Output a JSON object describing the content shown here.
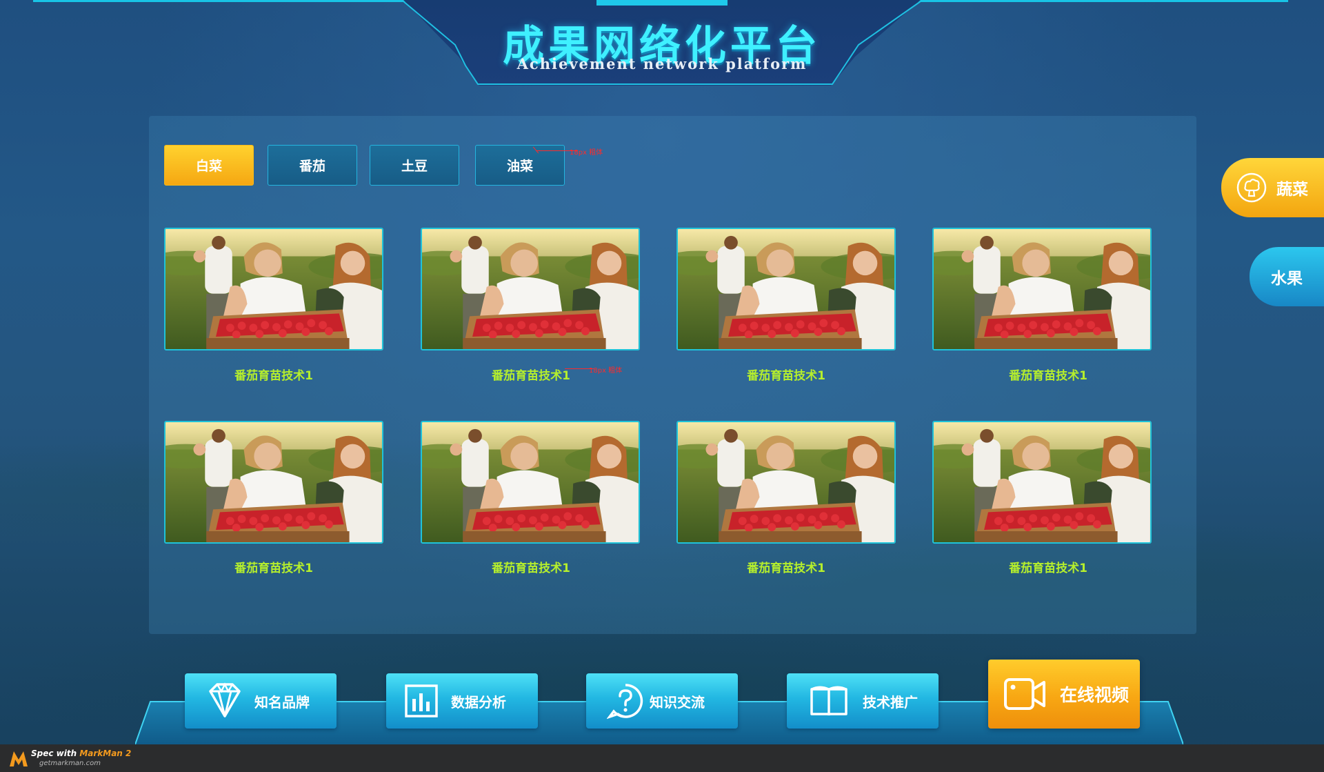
{
  "header": {
    "title_cn": "成果网络化平台",
    "title_en": "Achievement network platform"
  },
  "tabs": [
    {
      "label": "白菜",
      "active": true
    },
    {
      "label": "番茄",
      "active": false
    },
    {
      "label": "土豆",
      "active": false
    },
    {
      "label": "油菜",
      "active": false
    }
  ],
  "annotations": {
    "tab_note": "18px 粗体",
    "card_note": "18px 粗体"
  },
  "cards": [
    {
      "title": "番茄育苗技术1"
    },
    {
      "title": "番茄育苗技术1"
    },
    {
      "title": "番茄育苗技术1"
    },
    {
      "title": "番茄育苗技术1"
    },
    {
      "title": "番茄育苗技术1"
    },
    {
      "title": "番茄育苗技术1"
    },
    {
      "title": "番茄育苗技术1"
    },
    {
      "title": "番茄育苗技术1"
    }
  ],
  "side": {
    "vegetables": {
      "label": "蔬菜",
      "icon": "broccoli-icon"
    },
    "fruit": {
      "label": "水果"
    }
  },
  "bottom_nav": [
    {
      "label": "知名品牌",
      "icon": "diamond-icon"
    },
    {
      "label": "数据分析",
      "icon": "bar-chart-icon"
    },
    {
      "label": "知识交流",
      "icon": "question-icon"
    },
    {
      "label": "技术推广",
      "icon": "book-icon"
    },
    {
      "label": "在线视频",
      "icon": "video-camera-icon"
    }
  ],
  "footer": {
    "spec_prefix": "Spec with ",
    "spec_brand": "MarkMan 2",
    "url": "getmarkman.com"
  },
  "colors": {
    "accent_cyan": "#3ff0ff",
    "active_tab": "#f5a712",
    "card_title": "#b6ef2c",
    "card_border": "#1fc3d9"
  }
}
